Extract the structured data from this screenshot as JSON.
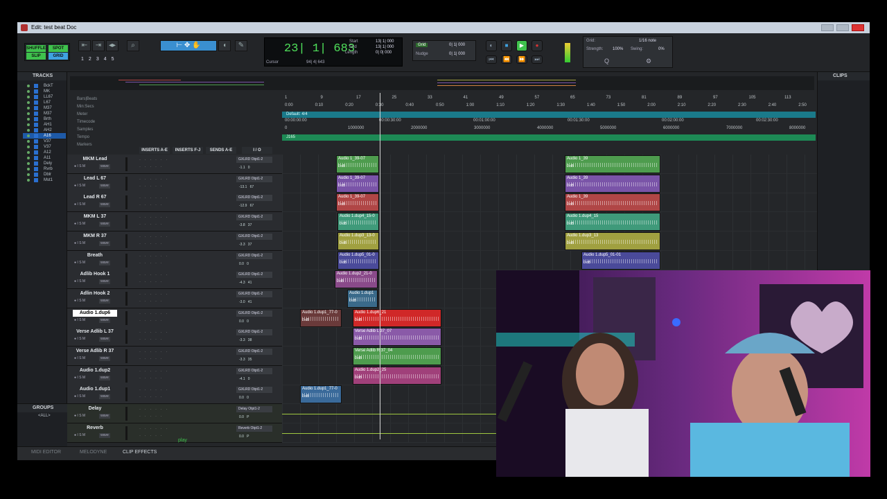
{
  "window": {
    "title": "Edit: test beat Doc"
  },
  "toolbar": {
    "modes": [
      "SHUFFLE",
      "SPOT",
      "SLIP",
      "GRID"
    ],
    "zoom_presets": [
      "1",
      "2",
      "3",
      "4",
      "5"
    ],
    "counter": "23| 1| 683",
    "start_label": "Start",
    "end_label": "End",
    "length_label": "Length",
    "start_val": "13| 1| 000",
    "end_val": "13| 1| 000",
    "length_val": "0| 0| 000",
    "cursor_label": "Cursor",
    "cursor_val": "94| 4| 643",
    "grid_label": "Grid",
    "nudge_label": "Nudge",
    "grid_val": "0| 1| 000",
    "nudge_val": "0| 1| 000",
    "grid_right_label": "Grid:",
    "grid_note": "1/16 note",
    "strength_label": "Strength:",
    "strength_val": "100%",
    "swing_label": "Swing:",
    "swing_val": "0%"
  },
  "tracks_panel": {
    "title": "TRACKS",
    "items": [
      "BckT",
      "MK",
      "LL67",
      "L67",
      "M37",
      "M37",
      "Brth",
      "AH1",
      "AH2",
      "A16",
      "V37",
      "V37",
      "A12",
      "A11",
      "Dely",
      "Rvrb",
      "Dblr",
      "Mst1"
    ],
    "selected_index": 9
  },
  "groups_panel": {
    "title": "GROUPS",
    "all_label": "<ALL>"
  },
  "clips_panel": {
    "title": "CLIPS"
  },
  "rulers": {
    "labels": [
      "Bars|Beats",
      "Min:Secs",
      "Meter",
      "Timecode",
      "Samples",
      "Tempo",
      "Markers"
    ],
    "bars": [
      "1",
      "9",
      "17",
      "25",
      "33",
      "41",
      "49",
      "57",
      "65",
      "73",
      "81",
      "89",
      "97",
      "105",
      "113"
    ],
    "mins": [
      "0:00",
      "0:10",
      "0:20",
      "0:30",
      "0:40",
      "0:50",
      "1:00",
      "1:10",
      "1:20",
      "1:30",
      "1:40",
      "1:50",
      "2:00",
      "2:10",
      "2:20",
      "2:30",
      "2:40",
      "2:50"
    ],
    "meter_text": "Default: 4/4",
    "timecode": [
      "00:00:00:00",
      "00:00:30:00",
      "00:01:00:00",
      "00:01:30:00",
      "00:02:00:00",
      "00:02:30:00"
    ],
    "samples": [
      "0",
      "1000000",
      "2000000",
      "3000000",
      "4000000",
      "5000000",
      "6000000",
      "7000000",
      "8000000"
    ],
    "tempo_text": "J165"
  },
  "columns": {
    "inserts_ae": "INSERTS A-E",
    "inserts_fj": "INSERTS F-J",
    "sends_ae": "SENDS A-E",
    "io": "I / O"
  },
  "tracks": [
    {
      "name": "MKM Lead",
      "io": "GXLRD",
      "out": "Otpt1-2",
      "vol": "-1.1",
      "pan": "0"
    },
    {
      "name": "Lead L 67",
      "io": "GXLRD",
      "out": "Otpt1-2",
      "vol": "-13.1",
      "pan": "67"
    },
    {
      "name": "Lead R 67",
      "io": "GXLRD",
      "out": "Otpt1-2",
      "vol": "-12.9",
      "pan": "67"
    },
    {
      "name": "MKM L 37",
      "io": "GXLRD",
      "out": "Otpt1-2",
      "vol": "-3.8",
      "pan": "37"
    },
    {
      "name": "MKM R 37",
      "io": "GXLRD",
      "out": "Otpt1-2",
      "vol": "-3.3",
      "pan": "37"
    },
    {
      "name": "Breath",
      "io": "GXLRD",
      "out": "Otpt1-2",
      "vol": "0.0",
      "pan": "0"
    },
    {
      "name": "Adlib Hook 1",
      "io": "GXLRD",
      "out": "Otpt1-2",
      "vol": "-4.3",
      "pan": "41"
    },
    {
      "name": "Adlin Hook 2",
      "io": "GXLRD",
      "out": "Otpt1-2",
      "vol": "-3.0",
      "pan": "41"
    },
    {
      "name": "Audio 1.dup6",
      "io": "GXLRD",
      "out": "Otpt1-2",
      "vol": "0.0",
      "pan": "0"
    },
    {
      "name": "Verse Adlib L 37",
      "io": "GXLRD",
      "out": "Otpt1-2",
      "vol": "-3.3",
      "pan": "38"
    },
    {
      "name": "Verse Adlib R 37",
      "io": "GXLRD",
      "out": "Otpt1-2",
      "vol": "-3.3",
      "pan": "35"
    },
    {
      "name": "Audio 1.dup2",
      "io": "GXLRD",
      "out": "Otpt1-2",
      "vol": "-4.1",
      "pan": "0"
    },
    {
      "name": "Audio 1.dup1",
      "io": "GXLRD",
      "out": "Otpt1-2",
      "vol": "0.0",
      "pan": "0"
    },
    {
      "name": "Delay",
      "io": "Delay",
      "out": "Otpt1-2",
      "vol": "0.0",
      "pan": "P"
    },
    {
      "name": "Reverb",
      "io": "Reverb",
      "out": "Otpt1-2",
      "vol": "0.0",
      "pan": "P"
    }
  ],
  "clips": [
    {
      "lane": 0,
      "name": "Audio 1_39-07",
      "db": "0 dB",
      "color": "#4e9c4e"
    },
    {
      "lane": 0,
      "name": "Audio 1_39",
      "db": "0 dB",
      "color": "#4e9c4e"
    },
    {
      "lane": 1,
      "name": "Audio 1_39-07",
      "db": "0 dB",
      "color": "#7a54a8"
    },
    {
      "lane": 1,
      "name": "Audio 1_39",
      "db": "0 dB",
      "color": "#7a54a8"
    },
    {
      "lane": 2,
      "name": "Audio 1_39-07",
      "db": "0 dB",
      "color": "#b04646"
    },
    {
      "lane": 2,
      "name": "Audio 1_39",
      "db": "0 dB",
      "color": "#b04646"
    },
    {
      "lane": 3,
      "name": "Audio 1.dup4_15-0",
      "db": "0 dB",
      "color": "#3f9a7a"
    },
    {
      "lane": 3,
      "name": "Audio 1.dup4_15",
      "db": "0 dB",
      "color": "#3f9a7a"
    },
    {
      "lane": 4,
      "name": "Audio 1.dup3_13-0",
      "db": "0 dB",
      "color": "#a0a040"
    },
    {
      "lane": 4,
      "name": "Audio 1.dup3_13",
      "db": "0 dB",
      "color": "#a0a040"
    },
    {
      "lane": 5,
      "name": "Audio 1.dup5_01-0",
      "db": "0 dB",
      "color": "#4a4a9a"
    },
    {
      "lane": 5,
      "name": "Audio 1.dup5_01-01",
      "db": "0 dB",
      "color": "#4a4a9a"
    },
    {
      "lane": 6,
      "name": "Audio 1.dup2_21-0",
      "db": "0 dB",
      "color": "#8a4a8a"
    },
    {
      "lane": 7,
      "name": "Audio 1.dup1",
      "db": "0 dB",
      "color": "#3a6a8a"
    },
    {
      "lane": 8,
      "name": "Audio 1.dup1_77-0",
      "db": "0 dB",
      "color": "#6a3a3a"
    },
    {
      "lane": 8,
      "name": "Audio 1.dup6_21",
      "db": "0 dB",
      "color": "#d02828"
    },
    {
      "lane": 9,
      "name": "Verse Adlib L 37_07",
      "db": "0 dB",
      "color": "#8a5aa8"
    },
    {
      "lane": 10,
      "name": "Verse Adlib R 37_04",
      "db": "0 dB",
      "color": "#4e9c4e"
    },
    {
      "lane": 11,
      "name": "Audio 1.dup2_25",
      "db": "0 dB",
      "color": "#a0407a"
    },
    {
      "lane": 12,
      "name": "Audio 1.dup1_77-0",
      "db": "0 dB",
      "color": "#3a6a9a"
    }
  ],
  "bottom_tabs": {
    "midi": "MIDI EDITOR",
    "melodyne": "MELODYNE",
    "clip_effects": "CLIP EFFECTS"
  },
  "play_label": "play"
}
